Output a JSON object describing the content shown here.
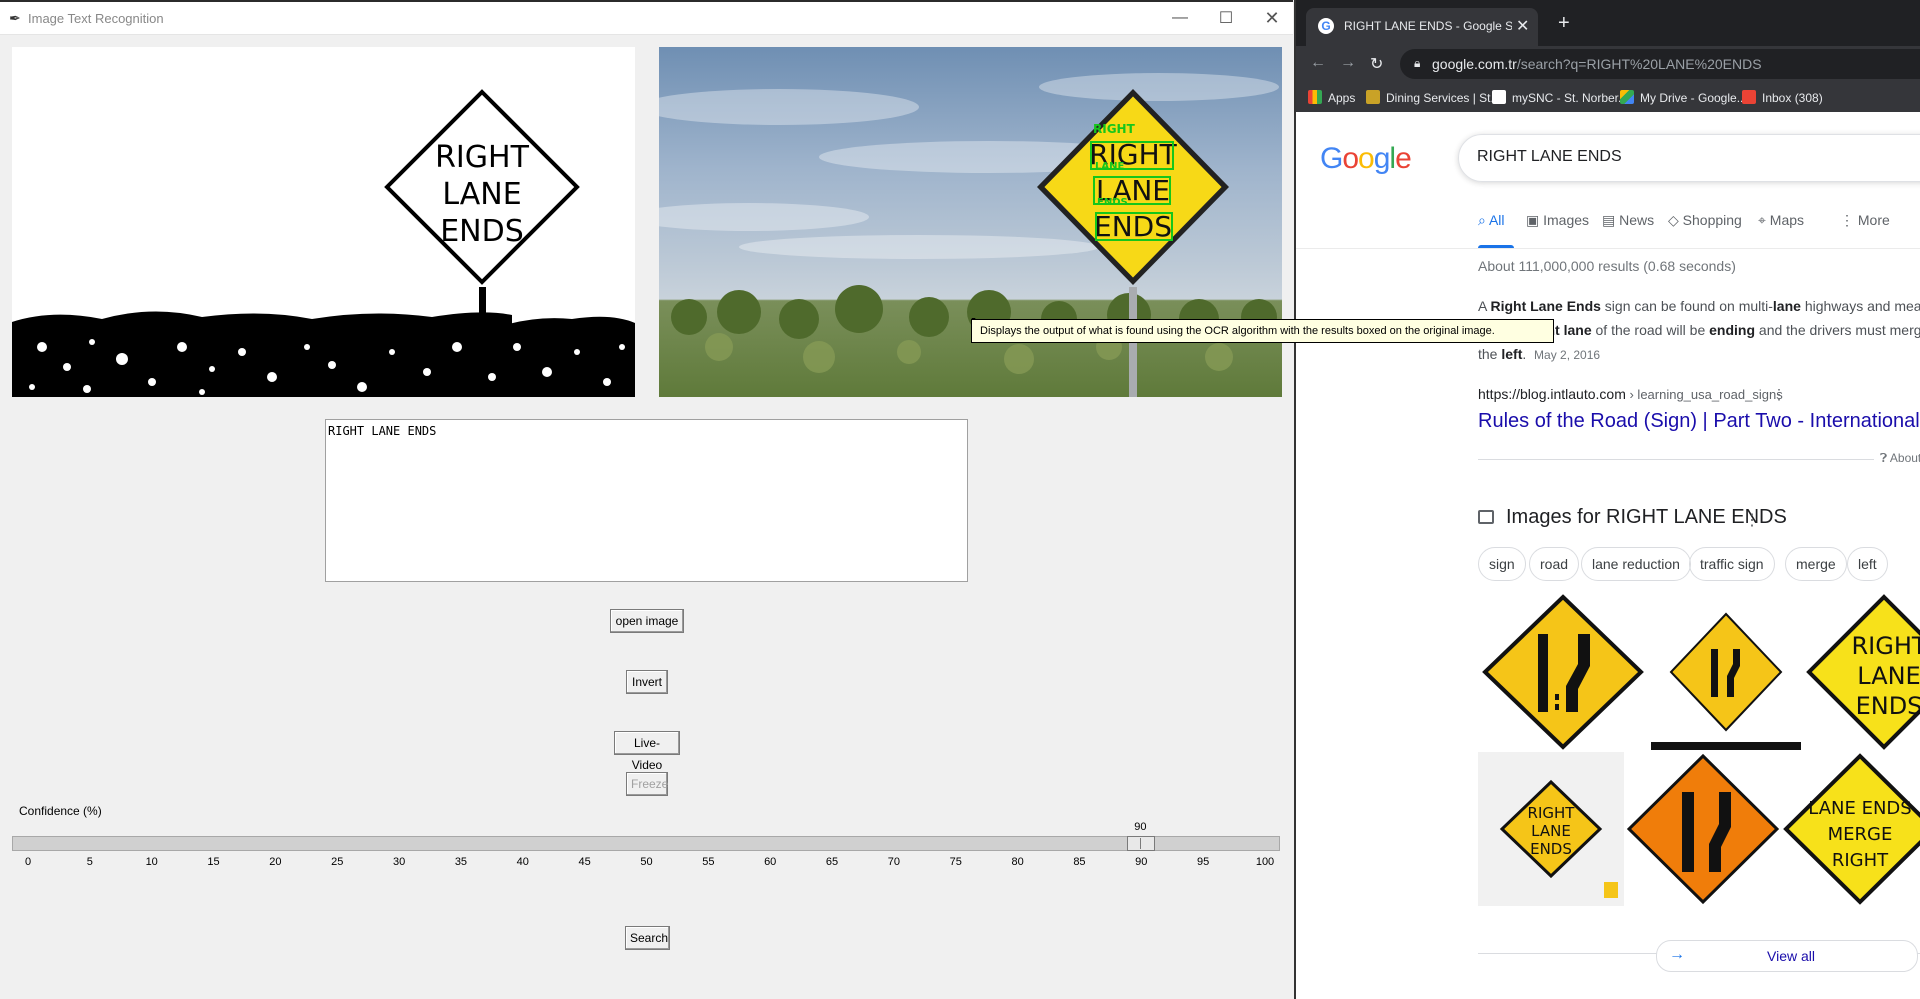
{
  "app": {
    "title": "Image Text Recognition",
    "title_icon": "feather-icon",
    "window_controls": [
      "—",
      "☐",
      "✕"
    ]
  },
  "images": {
    "threshold_sign_lines": [
      "RIGHT",
      "LANE",
      "ENDS"
    ],
    "photo_sign_lines": [
      "RIGHT",
      "LANE",
      "ENDS"
    ],
    "ocr_overlay_words": [
      "RIGHT",
      "LANE",
      "ENDS"
    ],
    "ocr_box_color": "#16c61b",
    "sign_color": "#f7d917"
  },
  "ocr": {
    "text": "RIGHT LANE ENDS"
  },
  "buttons": {
    "open": "open image",
    "invert": "Invert",
    "live": "Live-Video",
    "freeze": "Freeze",
    "search": "Search"
  },
  "confidence": {
    "label": "Confidence (%)",
    "value": 90,
    "value_text": "90",
    "min": 0,
    "max": 100,
    "ticks": [
      "0",
      "5",
      "10",
      "15",
      "20",
      "25",
      "30",
      "35",
      "40",
      "45",
      "50",
      "55",
      "60",
      "65",
      "70",
      "75",
      "80",
      "85",
      "90",
      "95",
      "100"
    ]
  },
  "tooltip": "Displays the output of what is found using the OCR algorithm with the results boxed on the original image.",
  "browser": {
    "tab_title": "RIGHT LANE ENDS - Google Search",
    "tab_close": "✕",
    "new_tab": "+",
    "url_domain": "google.com.tr",
    "url_path": "/search?q=RIGHT%20LANE%20ENDS",
    "bookmarks": [
      "Apps",
      "Dining Services | St...",
      "mySNC - St. Norber...",
      "My Drive - Google...",
      "Inbox (308)"
    ]
  },
  "google": {
    "logo": "Google",
    "query": "RIGHT LANE ENDS",
    "tabs": [
      "All",
      "Images",
      "News",
      "Shopping",
      "Maps",
      "More"
    ],
    "stats": "About 111,000,000 results (0.68 seconds)",
    "snippet": {
      "t1": "A ",
      "b1": "Right Lane Ends",
      "t2": " sign can be found on multi-",
      "b2": "lane",
      "t3": " highways and means that the ",
      "b3": "right lane",
      "t4": " of the road will be ",
      "b4": "ending",
      "t5": " and the drivers must merge to the ",
      "b5": "left",
      "t6": ".",
      "date": "May 2, 2016"
    },
    "cite_url": "https://blog.intlauto.com",
    "cite_crumb": " › learning_usa_road_signs",
    "result_title": "Rules of the Road (Sign) | Part Two - International Auto",
    "about": "About",
    "images_header": "Images for RIGHT LANE ENDS",
    "chips": [
      "sign",
      "road",
      "lane reduction",
      "traffic sign",
      "merge",
      "left"
    ],
    "thumb_texts": {
      "t3": [
        "RIGHT",
        "LANE",
        "ENDS"
      ],
      "t4": [
        "RIGHT",
        "LANE",
        "ENDS"
      ],
      "t6": [
        "LANE ENDS",
        "MERGE",
        "RIGHT"
      ]
    },
    "view_all": "View all"
  }
}
